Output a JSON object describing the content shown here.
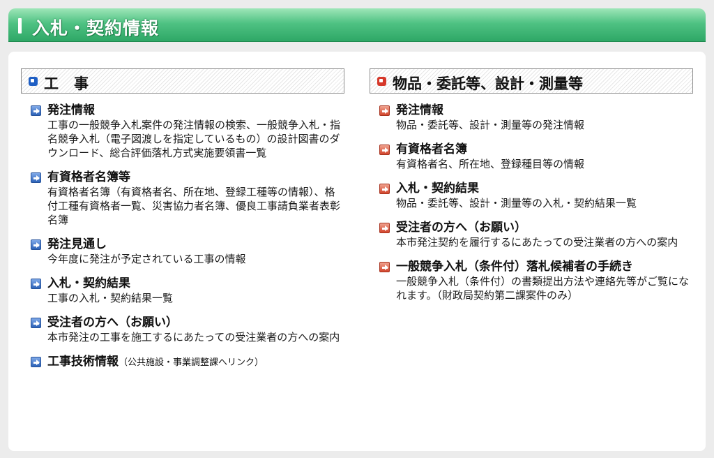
{
  "header": {
    "title": "入札・契約情報"
  },
  "left": {
    "heading": "工事",
    "items": [
      {
        "title": "発注情報",
        "desc": "工事の一般競争入札案件の発注情報の検索、一般競争入札・指名競争入札（電子図渡しを指定しているもの）の設計図書のダウンロード、総合評価落札方式実施要領書一覧"
      },
      {
        "title": "有資格者名簿等",
        "desc": "有資格者名簿（有資格者名、所在地、登録工種等の情報）、格付工種有資格者一覧、災害協力者名簿、優良工事請負業者表彰名簿"
      },
      {
        "title": "発注見通し",
        "desc": "今年度に発注が予定されている工事の情報"
      },
      {
        "title": "入札・契約結果",
        "desc": "工事の入札・契約結果一覧"
      },
      {
        "title": "受注者の方へ（お願い）",
        "desc": "本市発注の工事を施工するにあたっての受注業者の方への案内"
      },
      {
        "title": "工事技術情報",
        "note": "（公共施設・事業調整課へリンク）",
        "desc": ""
      }
    ]
  },
  "right": {
    "heading": "物品・委託等、設計・測量等",
    "items": [
      {
        "title": "発注情報",
        "desc": "物品・委託等、設計・測量等の発注情報"
      },
      {
        "title": "有資格者名簿",
        "desc": "有資格者名、所在地、登録種目等の情報"
      },
      {
        "title": "入札・契約結果",
        "desc": "物品・委託等、設計・測量等の入札・契約結果一覧"
      },
      {
        "title": "受注者の方へ（お願い）",
        "desc": "本市発注契約を履行するにあたっての受注業者の方への案内"
      },
      {
        "title": "一般競争入札（条件付）落札候補者の手続き",
        "desc": "一般競争入札（条件付）の書類提出方法や連絡先等がご覧になれます。（財政局契約第二課案件のみ）"
      }
    ]
  },
  "colors": {
    "header_green": "#3fb877",
    "left_accent": "#1f5fc4",
    "right_accent": "#d6382a"
  },
  "icons": {
    "left_heading": "blue-square-icon",
    "right_heading": "red-square-icon",
    "left_bullet": "blue-arrow-icon",
    "right_bullet": "red-arrow-icon"
  }
}
